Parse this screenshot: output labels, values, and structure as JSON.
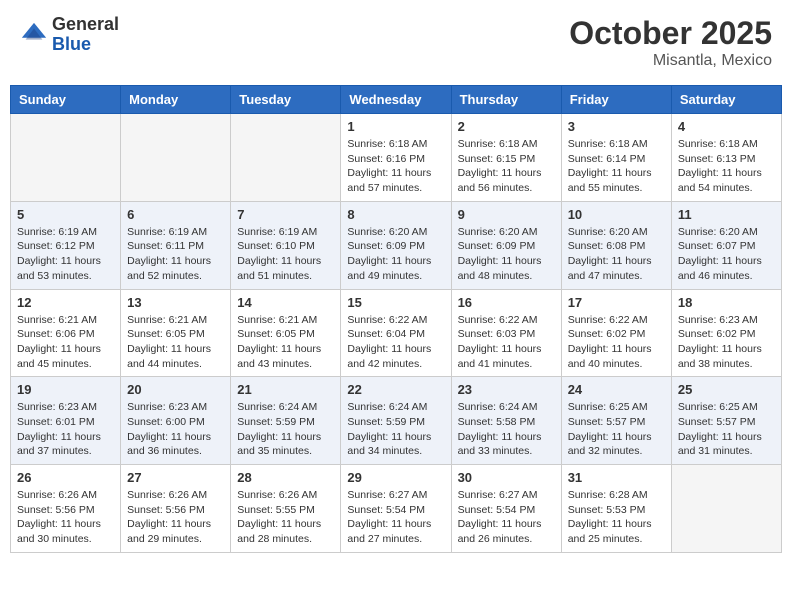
{
  "header": {
    "logo_line1": "General",
    "logo_line2": "Blue",
    "month": "October 2025",
    "location": "Misantla, Mexico"
  },
  "weekdays": [
    "Sunday",
    "Monday",
    "Tuesday",
    "Wednesday",
    "Thursday",
    "Friday",
    "Saturday"
  ],
  "weeks": [
    [
      {
        "day": "",
        "info": ""
      },
      {
        "day": "",
        "info": ""
      },
      {
        "day": "",
        "info": ""
      },
      {
        "day": "1",
        "info": "Sunrise: 6:18 AM\nSunset: 6:16 PM\nDaylight: 11 hours and 57 minutes."
      },
      {
        "day": "2",
        "info": "Sunrise: 6:18 AM\nSunset: 6:15 PM\nDaylight: 11 hours and 56 minutes."
      },
      {
        "day": "3",
        "info": "Sunrise: 6:18 AM\nSunset: 6:14 PM\nDaylight: 11 hours and 55 minutes."
      },
      {
        "day": "4",
        "info": "Sunrise: 6:18 AM\nSunset: 6:13 PM\nDaylight: 11 hours and 54 minutes."
      }
    ],
    [
      {
        "day": "5",
        "info": "Sunrise: 6:19 AM\nSunset: 6:12 PM\nDaylight: 11 hours and 53 minutes."
      },
      {
        "day": "6",
        "info": "Sunrise: 6:19 AM\nSunset: 6:11 PM\nDaylight: 11 hours and 52 minutes."
      },
      {
        "day": "7",
        "info": "Sunrise: 6:19 AM\nSunset: 6:10 PM\nDaylight: 11 hours and 51 minutes."
      },
      {
        "day": "8",
        "info": "Sunrise: 6:20 AM\nSunset: 6:09 PM\nDaylight: 11 hours and 49 minutes."
      },
      {
        "day": "9",
        "info": "Sunrise: 6:20 AM\nSunset: 6:09 PM\nDaylight: 11 hours and 48 minutes."
      },
      {
        "day": "10",
        "info": "Sunrise: 6:20 AM\nSunset: 6:08 PM\nDaylight: 11 hours and 47 minutes."
      },
      {
        "day": "11",
        "info": "Sunrise: 6:20 AM\nSunset: 6:07 PM\nDaylight: 11 hours and 46 minutes."
      }
    ],
    [
      {
        "day": "12",
        "info": "Sunrise: 6:21 AM\nSunset: 6:06 PM\nDaylight: 11 hours and 45 minutes."
      },
      {
        "day": "13",
        "info": "Sunrise: 6:21 AM\nSunset: 6:05 PM\nDaylight: 11 hours and 44 minutes."
      },
      {
        "day": "14",
        "info": "Sunrise: 6:21 AM\nSunset: 6:05 PM\nDaylight: 11 hours and 43 minutes."
      },
      {
        "day": "15",
        "info": "Sunrise: 6:22 AM\nSunset: 6:04 PM\nDaylight: 11 hours and 42 minutes."
      },
      {
        "day": "16",
        "info": "Sunrise: 6:22 AM\nSunset: 6:03 PM\nDaylight: 11 hours and 41 minutes."
      },
      {
        "day": "17",
        "info": "Sunrise: 6:22 AM\nSunset: 6:02 PM\nDaylight: 11 hours and 40 minutes."
      },
      {
        "day": "18",
        "info": "Sunrise: 6:23 AM\nSunset: 6:02 PM\nDaylight: 11 hours and 38 minutes."
      }
    ],
    [
      {
        "day": "19",
        "info": "Sunrise: 6:23 AM\nSunset: 6:01 PM\nDaylight: 11 hours and 37 minutes."
      },
      {
        "day": "20",
        "info": "Sunrise: 6:23 AM\nSunset: 6:00 PM\nDaylight: 11 hours and 36 minutes."
      },
      {
        "day": "21",
        "info": "Sunrise: 6:24 AM\nSunset: 5:59 PM\nDaylight: 11 hours and 35 minutes."
      },
      {
        "day": "22",
        "info": "Sunrise: 6:24 AM\nSunset: 5:59 PM\nDaylight: 11 hours and 34 minutes."
      },
      {
        "day": "23",
        "info": "Sunrise: 6:24 AM\nSunset: 5:58 PM\nDaylight: 11 hours and 33 minutes."
      },
      {
        "day": "24",
        "info": "Sunrise: 6:25 AM\nSunset: 5:57 PM\nDaylight: 11 hours and 32 minutes."
      },
      {
        "day": "25",
        "info": "Sunrise: 6:25 AM\nSunset: 5:57 PM\nDaylight: 11 hours and 31 minutes."
      }
    ],
    [
      {
        "day": "26",
        "info": "Sunrise: 6:26 AM\nSunset: 5:56 PM\nDaylight: 11 hours and 30 minutes."
      },
      {
        "day": "27",
        "info": "Sunrise: 6:26 AM\nSunset: 5:56 PM\nDaylight: 11 hours and 29 minutes."
      },
      {
        "day": "28",
        "info": "Sunrise: 6:26 AM\nSunset: 5:55 PM\nDaylight: 11 hours and 28 minutes."
      },
      {
        "day": "29",
        "info": "Sunrise: 6:27 AM\nSunset: 5:54 PM\nDaylight: 11 hours and 27 minutes."
      },
      {
        "day": "30",
        "info": "Sunrise: 6:27 AM\nSunset: 5:54 PM\nDaylight: 11 hours and 26 minutes."
      },
      {
        "day": "31",
        "info": "Sunrise: 6:28 AM\nSunset: 5:53 PM\nDaylight: 11 hours and 25 minutes."
      },
      {
        "day": "",
        "info": ""
      }
    ]
  ]
}
